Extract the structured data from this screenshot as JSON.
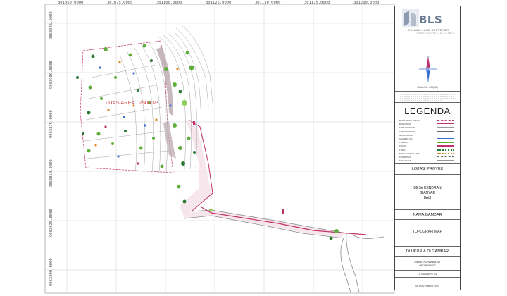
{
  "grid": {
    "x_labels": [
      "301050.0000",
      "301075.0000",
      "301100.0000",
      "301125.0000",
      "301150.0000",
      "301175.0000",
      "301200.0000"
    ],
    "y_labels": [
      "9063925.0000",
      "9063900.0000",
      "9063875.0000",
      "9063850.0000",
      "9063825.0000",
      "9063800.0000"
    ]
  },
  "map": {
    "area_label": "LUAS AREA : 2500 M²",
    "colors": {
      "contour": "#9a9a9a",
      "boundary": "#c0306a",
      "road": "#8a8a8a",
      "tree_green": "#5fae3c",
      "tree_dark": "#2f7a33",
      "marker_blue": "#3b6fd0",
      "marker_orange": "#e08a2a",
      "road_fill": "#f1d6de",
      "area_text": "#d24a4a"
    }
  },
  "panel": {
    "logo": {
      "text": "BLS",
      "company": "C.V BALI LAND SURVEYOR",
      "tagline": "TOPOGRAPHIC & ESTATE"
    },
    "scale_text": "SKALA 1 : 600(A3)",
    "legend_title": "LEGENDA",
    "legend_items": [
      {
        "label": "BATAS PENGUKURAN",
        "color": "#c0306a",
        "style": "dash"
      },
      {
        "label": "BANGUNAN",
        "color": "#c0306a",
        "style": "solid"
      },
      {
        "label": "KONTUR MINOR",
        "color": "#9a9a9a",
        "style": "solid"
      },
      {
        "label": "KONTUR MAYOR",
        "color": "#666666",
        "style": "solid"
      },
      {
        "label": "JALAN TANAH",
        "color": "#8a8a8a",
        "style": "double"
      },
      {
        "label": "SALURAN AIR",
        "color": "#3b6fd0",
        "style": "solid"
      },
      {
        "label": "TEMBOK",
        "color": "#5fae3c",
        "style": "fill"
      },
      {
        "label": "POHON",
        "color": "#c0306a",
        "style": "fill"
      },
      {
        "label": "TIANG",
        "color": "#2f7a33",
        "style": "dots"
      },
      {
        "label": "BENCH MARK & TITIK",
        "color": "#e08a2a",
        "style": "dots"
      },
      {
        "label": "KOORDINAT",
        "color": "#666666",
        "style": "wave"
      },
      {
        "label": "TITIK DETAIL",
        "color": "#999999",
        "style": "solid"
      }
    ],
    "sections": {
      "project_title": "LOKASI PROYEK",
      "project_lines": [
        "DESA KENDRAN",
        "GIANYAR",
        "BALI"
      ],
      "drawing_title": "NAMA GAMBAR",
      "drawing_name": "TOPOGRAFI MAP",
      "surveyed_title": "DI UKUR & DI GAMBAR",
      "surveyor_name": "I MADE NURBAWA, ST",
      "surveyor_phone": "081236685977",
      "date_title": "DI GAMBAR TGL",
      "date_value": "08 NOVEMBER 2024"
    }
  }
}
